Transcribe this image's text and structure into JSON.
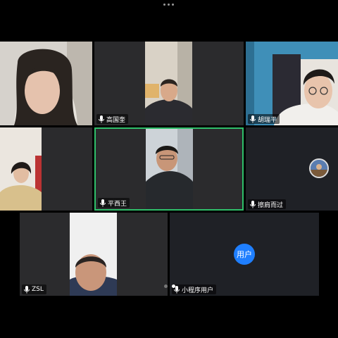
{
  "window": {
    "menu_icon": "more-dots-icon"
  },
  "participants": [
    {
      "name": "",
      "icon": "mic-icon"
    },
    {
      "name": "高国奎",
      "icon": "mic-icon"
    },
    {
      "name": "胡瑞平",
      "icon": "mic-icon"
    },
    {
      "name": "",
      "icon": "mic-icon"
    },
    {
      "name": "平西王",
      "icon": "mic-icon",
      "active": true
    },
    {
      "name": "擦肩而过",
      "icon": "mic-icon"
    },
    {
      "name": "ZSL",
      "icon": "mic-icon"
    },
    {
      "name": "小程序用户",
      "icon": "mic-icon",
      "avatar_text": "用户"
    }
  ],
  "colors": {
    "active_border": "#2fbf6a",
    "avatar_blue": "#1f7fff",
    "tile_bg": "#2b2b2d"
  },
  "pager": {
    "pages": 2,
    "current": 2
  }
}
